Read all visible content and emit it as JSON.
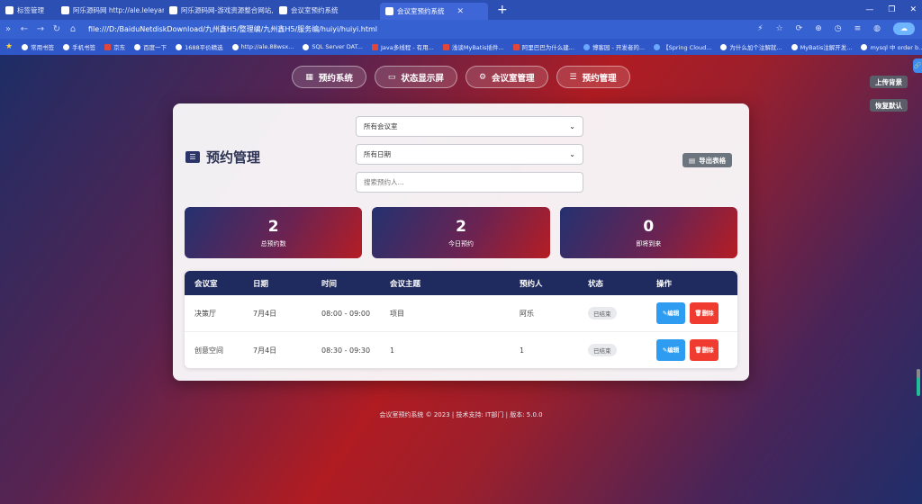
{
  "browser": {
    "tabs": [
      {
        "label": "标签管理",
        "active": false
      },
      {
        "label": "阿乐源码网 http://ale.leleyang...",
        "active": false
      },
      {
        "label": "阿乐源码网-游戏资源整合网站,不...",
        "active": false
      },
      {
        "label": "会议室预约系统",
        "active": false
      },
      {
        "label": "会议室预约系统",
        "active": true
      }
    ],
    "url": "file:///D:/BaiduNetdiskDownload/九州鑫H5/整理编/九州鑫H5/服务编/huiyi/huiyi.html",
    "bookmarks": [
      "常用书签",
      "手机书签",
      "京东",
      "百度一下",
      "1688平价精选",
      "http://ale.88wsx...",
      "SQL Server DAT...",
      "Java多线程 - 有用...",
      "浅谈MyBatis插件...",
      "阿里巴巴为什么建...",
      "博客园 - 开发者的...",
      "【Spring Cloud...",
      "为什么加个注解就...",
      "MyBatis注解开发...",
      "mysql 中 order b..."
    ]
  },
  "nav": {
    "items": [
      {
        "label": "预约系统",
        "icon": "calendar-icon"
      },
      {
        "label": "状态显示屏",
        "icon": "monitor-icon"
      },
      {
        "label": "会议室管理",
        "icon": "gear-icon"
      },
      {
        "label": "预约管理",
        "icon": "list-icon"
      }
    ]
  },
  "side": {
    "upload_label": "上传背景",
    "reset_label": "恢复默认"
  },
  "header": {
    "title": "预约管理",
    "export_label": "导出表格"
  },
  "filters": {
    "room_selected": "所有会议室",
    "date_selected": "所有日期",
    "search_placeholder": "搜索预约人..."
  },
  "stats": [
    {
      "value": "2",
      "label": "总预约数"
    },
    {
      "value": "2",
      "label": "今日预约"
    },
    {
      "value": "0",
      "label": "即将到来"
    }
  ],
  "table": {
    "columns": [
      "会议室",
      "日期",
      "时间",
      "会议主题",
      "预约人",
      "状态",
      "操作"
    ],
    "rows": [
      {
        "room": "决策厅",
        "date": "7月4日",
        "time": "08:00 - 09:00",
        "topic": "项目",
        "person": "阿乐",
        "status": "已结束"
      },
      {
        "room": "创意空间",
        "date": "7月4日",
        "time": "08:30 - 09:30",
        "topic": "1",
        "person": "1",
        "status": "已结束"
      }
    ],
    "edit_label": "编辑",
    "delete_label": "删除"
  },
  "footer": {
    "text": "会议室预约系统 © 2023 | 技术支持: IT部门 | 版本: 5.0.0"
  }
}
